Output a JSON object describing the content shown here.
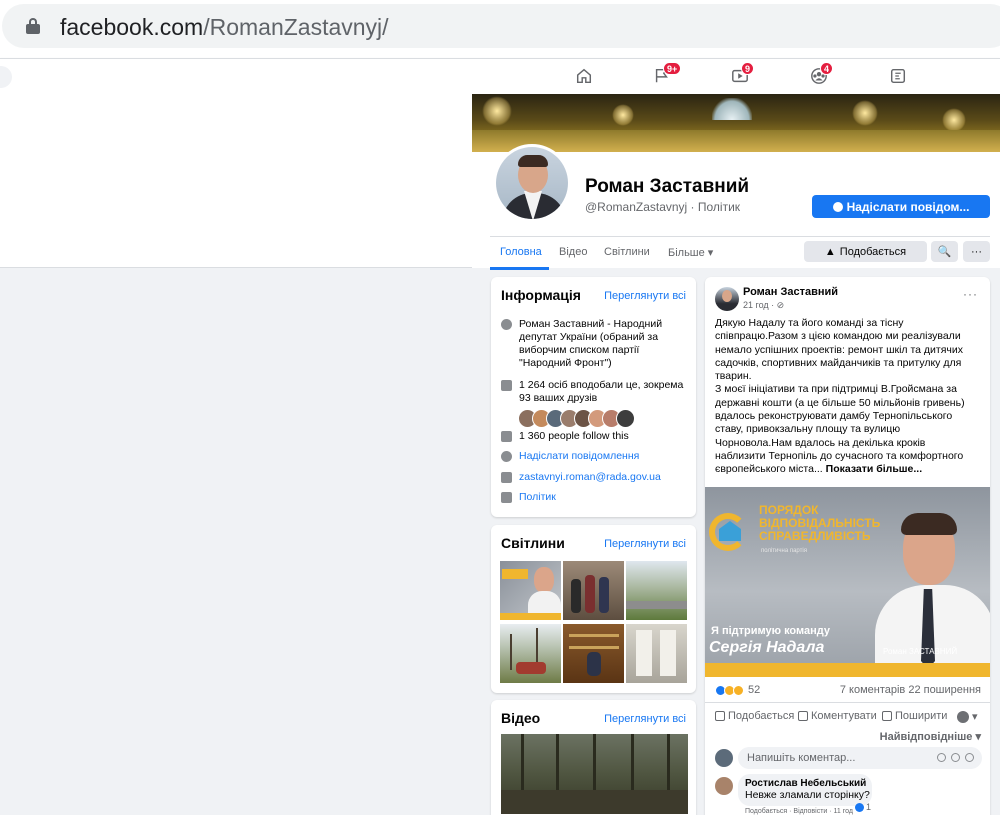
{
  "browser": {
    "url_domain": "facebook.com",
    "url_path": "/RomanZastavnyj/"
  },
  "nav": {
    "icons": [
      "home-icon",
      "pages-flag-icon",
      "watch-icon",
      "groups-icon",
      "gaming-icon"
    ],
    "badges": {
      "pages": "9+",
      "watch": "9",
      "groups": "4"
    }
  },
  "profile": {
    "name": "Роман Заставний",
    "handle": "@RomanZastavnyj · Політик",
    "send_message": "Надіслати повідом...",
    "tabs": [
      "Головна",
      "Відео",
      "Світлини",
      "Більше ▾"
    ],
    "like_button": "Подобається",
    "search_button": "🔍",
    "more_button": "···"
  },
  "info": {
    "title": "Інформація",
    "see_all": "Переглянути всі",
    "about": "Роман Заставний - Народний депутат України (обраний за виборчим списком партії \"Народний Фронт\")",
    "likes": "1 264 осіб вподобали це, зокрема 93 ваших друзів",
    "follows": "1 360 people follow this",
    "send_message": "Надіслати повідомлення",
    "email": "zastavnyi.roman@rada.gov.ua",
    "category": "Політик"
  },
  "photos": {
    "title": "Світлини",
    "see_all": "Переглянути всі"
  },
  "videos": {
    "title": "Відео",
    "see_all": "Переглянути всі"
  },
  "post": {
    "author": "Роман Заставний",
    "time": "21 год · ⊘",
    "menu": "···",
    "text": "Дякую Надалу та його команді за тісну співпрацю.Разом з цією командою ми реалізували немало успішних проектів: ремонт шкіл та дитячих садочків, спортивних майданчиків та притулку для тварин.\nЗ моєї ініціативи та при підтримці В.Гройсмана за державні кошти (а це більше 50 мільйонів гривень) вдалось реконструювати дамбу Тернопільського ставу, привокзальну площу та вулицю Чорновола.Нам вдалось на декілька кроків наблизити Тернопіль до сучасного та комфортного європейського міста...",
    "show_more": "Показати більше...",
    "image": {
      "slogan1": "ПОРЯДОК",
      "slogan2": "ВІДПОВІДАЛЬНІСТЬ",
      "slogan3": "СПРАВЕДЛИВІСТЬ",
      "party": "політична партія",
      "support": "Я підтримую команду",
      "name": "Сергія Надала",
      "signature": "Роман ЗАСТАВНИЙ"
    },
    "reactions_count": "52",
    "comments_shares": "7 коментарів  22 поширення",
    "actions": [
      "Подобається",
      "Коментувати",
      "Поширити"
    ],
    "sort": "Найвідповідніше ▾",
    "comment_placeholder": "Напишіть коментар...",
    "comment": {
      "author": "Ростислав Небельський",
      "text": "Невже зламали сторінку?",
      "meta": "Подобається · Відповісти · 11 год",
      "likes": "1"
    }
  },
  "colors": {
    "fb_blue": "#1877f2",
    "badge_red": "#e41e3f",
    "text_secondary": "#65676b"
  }
}
